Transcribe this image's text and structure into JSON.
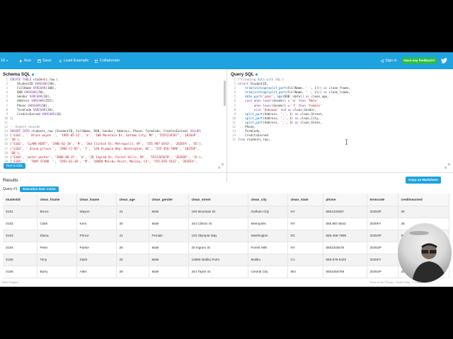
{
  "topbar": {
    "version": "18",
    "run_label": "Run",
    "save_label": "Save",
    "load_example_label": "Load Example",
    "collaborate_label": "Collaborate",
    "signin_label": "Sign in",
    "feedback_label": "Have any feedback?"
  },
  "schema_panel": {
    "title": "Schema SQL",
    "lines": [
      "CREATE TABLE students_raw (",
      "    StudentID VARCHAR(50),",
      "    FullName VARCHAR(100),",
      "    DOB VARCHAR(50),",
      "    Gender VARCHAR(20),",
      "    Address VARCHAR(255),",
      "    Phone VARCHAR(50),",
      "    TermCode VARCHAR(20),",
      "    CreditsEarned VARCHAR(10)",
      ");",
      "",
      "-- Insert records",
      "INSERT INTO students_raw (StudentID, FullName, DOB, Gender, Address, Phone, TermCode, CreditsEarned) VALUES",
      "('S101', '  Bruce wayne  ', '1985-05-12', 'm', '100 Mountain Dr, Gotham City, NY', '5551234567', '2026SP',",
      "'30'),",
      "('S102', 'CLARK KENT', '1986-02-28', 'M', '344 Clinton St, Metropolis, NY', '555.987.6543', '2026FA', '45'),",
      "('S103', ' diana prince ', '1984-11-05', 'f', '120 Olympia Way, Washington, DC', '555-456-7890', '2025SP',",
      "'60'),",
      "('S104', 'peter parker', '2000-08-15', 'm', '20 Ingram St, Forest Hills, NY', '5552345678', '2026SP', '15'),",
      "('S105', '  TONY STARK  ', '1993-01-30', 'M', '10880 Malibu Point, Malibu, CA', '555-876-5432', '2026FA',"
    ],
    "button_label": "Text to DDL"
  },
  "query_panel": {
    "title": "Query SQL",
    "lines": [
      "/*Cleaning Data with SQL*/",
      "select StudentID,",
      "    trim(initcap(split_part(FullName, ' ', 1))) as clean_fname,",
      "    trim(initcap(split_part(FullName, ' ', 2))) as clean_lname,",
      "    date_part('year', age(DOB::date)) as clean_age,",
      "    case when lower(Gender) = 'm' then 'Male'",
      "         when lower(Gender) = 'f' then 'Female'",
      "         else 'Unknown' end as clean_Gender,",
      "    split_part(Address, ',', 1) as clean_Street,",
      "    split_part(Address, ',', 2) as clean_City,",
      "    split_part(Address, ',', 3) as clean_State,",
      "    Phone,",
      "    TermCode,",
      "    CreditsEarned",
      "from students_raw;"
    ]
  },
  "results": {
    "title": "Results",
    "copy_button": "Copy as Markdown",
    "query_label": "Query #1",
    "execution_time": "Execution time: 0.0ms",
    "columns": [
      "studentid",
      "clean_fname",
      "clean_lname",
      "clean_age",
      "clean_gender",
      "clean_street",
      "clean_city",
      "clean_state",
      "phone",
      "termcode",
      "creditsearned"
    ],
    "rows": [
      [
        "S101",
        "Bruce",
        "Wayne",
        "31",
        "Male",
        "100 Mountain Dr",
        "Gotham City",
        "NY",
        "5551234567",
        "2026SP",
        "30"
      ],
      [
        "S102",
        "Clark",
        "Kent",
        "30",
        "Male",
        "344 Clinton St",
        "Metropolis",
        "NY",
        "555.987.6543",
        "2026FA",
        "45"
      ],
      [
        "S103",
        "Diana",
        "Prince",
        "31",
        "Female",
        "120 Olympia Way",
        "Washington",
        "DC",
        "555-456-7890",
        "2025SP",
        "60"
      ],
      [
        "S104",
        "Peter",
        "Parker",
        "26",
        "Male",
        "20 Ingram St",
        "Forest Hills",
        "NY",
        "5552345678",
        "2026SP",
        "15"
      ],
      [
        "S105",
        "Tony",
        "Stark",
        "33",
        "Male",
        "10880 Malibu Point",
        "Malibu",
        "CA",
        "555-876-5432",
        "2026FA",
        "50"
      ],
      [
        "S106",
        "Barry",
        "Allen",
        "29",
        "Male",
        "344 Taylor St",
        "Central City",
        "MO",
        "5553456789",
        "2026SP",
        "25"
      ]
    ]
  },
  "footer": {
    "left": "United Kingdom",
    "right": "Terms of Use / Privacy / Cookie Policy · © 2016-2026"
  },
  "colors": {
    "brand": "#1ea2e0",
    "feedback": "#2bbd4b"
  }
}
